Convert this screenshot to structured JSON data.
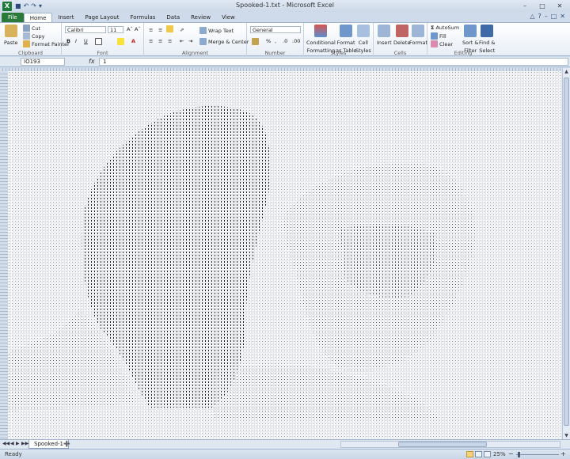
{
  "window": {
    "title": "Spooked-1.txt - Microsoft Excel",
    "app_icon": "excel-icon",
    "min": "–",
    "max": "□",
    "close": "✕"
  },
  "tabs": [
    {
      "label": "File"
    },
    {
      "label": "Home"
    },
    {
      "label": "Insert"
    },
    {
      "label": "Page Layout"
    },
    {
      "label": "Formulas"
    },
    {
      "label": "Data"
    },
    {
      "label": "Review"
    },
    {
      "label": "View"
    }
  ],
  "ribbon": {
    "clipboard": {
      "paste": "Paste",
      "cut": "Cut",
      "copy": "Copy",
      "format_painter": "Format Painter",
      "label": "Clipboard"
    },
    "font": {
      "name": "Calibri",
      "size": "11",
      "bold": "B",
      "italic": "I",
      "underline": "U",
      "label": "Font"
    },
    "alignment": {
      "wrap_text": "Wrap Text",
      "merge_center": "Merge & Center",
      "label": "Alignment"
    },
    "number": {
      "format": "General",
      "percent": "%",
      "comma": ",",
      "label": "Number"
    },
    "styles": {
      "conditional": "Conditional",
      "conditional2": "Formatting",
      "format_table": "Format",
      "format_table2": "as Table",
      "cell_styles": "Cell",
      "cell_styles2": "Styles",
      "label": "Styles"
    },
    "cells": {
      "insert": "Insert",
      "delete": "Delete",
      "format": "Format",
      "label": "Cells"
    },
    "editing": {
      "autosum": "AutoSum",
      "fill": "Fill",
      "clear": "Clear",
      "sort": "Sort &",
      "sort2": "Filter",
      "find": "Find &",
      "find2": "Select",
      "label": "Editing"
    }
  },
  "formula_bar": {
    "name_box": "IO193",
    "fx": "fx",
    "value": "1"
  },
  "sheet": {
    "tab": "Spooked-1"
  },
  "status": {
    "ready": "Ready",
    "zoom": "25%",
    "minus": "−",
    "plus": "+"
  },
  "colors": {
    "accent": "#1d7a3a",
    "ribbon_border": "#9fb3cc",
    "ink": "#2a2a2a"
  }
}
